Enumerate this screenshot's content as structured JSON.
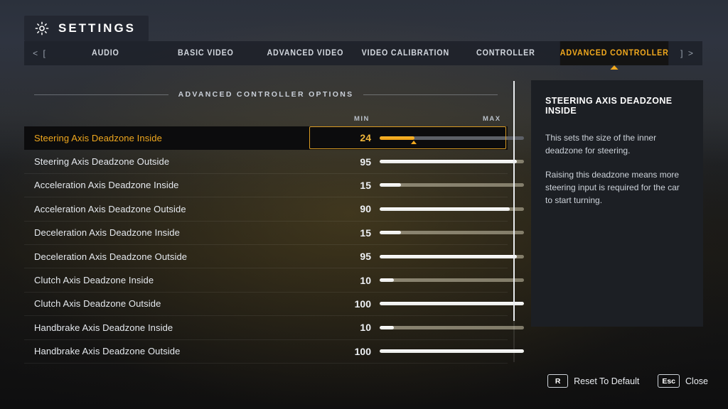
{
  "header": {
    "gear_icon": "gear-icon",
    "title": "SETTINGS"
  },
  "tabbar": {
    "prev_arrow": "< [",
    "next_arrow": "] >",
    "tabs": [
      {
        "label": "AUDIO",
        "active": false
      },
      {
        "label": "BASIC VIDEO",
        "active": false
      },
      {
        "label": "ADVANCED VIDEO",
        "active": false
      },
      {
        "label": "VIDEO CALIBRATION",
        "active": false
      },
      {
        "label": "CONTROLLER",
        "active": false
      },
      {
        "label": "ADVANCED CONTROLLER",
        "active": true
      }
    ]
  },
  "section": {
    "heading": "ADVANCED CONTROLLER OPTIONS",
    "min_label": "MIN",
    "max_label": "MAX"
  },
  "options": [
    {
      "label": "Steering Axis Deadzone Inside",
      "value": "24",
      "percent": 24,
      "selected": true
    },
    {
      "label": "Steering Axis Deadzone Outside",
      "value": "95",
      "percent": 95,
      "selected": false
    },
    {
      "label": "Acceleration Axis Deadzone Inside",
      "value": "15",
      "percent": 15,
      "selected": false
    },
    {
      "label": "Acceleration Axis Deadzone Outside",
      "value": "90",
      "percent": 90,
      "selected": false
    },
    {
      "label": "Deceleration Axis Deadzone Inside",
      "value": "15",
      "percent": 15,
      "selected": false
    },
    {
      "label": "Deceleration Axis Deadzone Outside",
      "value": "95",
      "percent": 95,
      "selected": false
    },
    {
      "label": "Clutch Axis Deadzone Inside",
      "value": "10",
      "percent": 10,
      "selected": false
    },
    {
      "label": "Clutch Axis Deadzone Outside",
      "value": "100",
      "percent": 100,
      "selected": false
    },
    {
      "label": "Handbrake Axis Deadzone Inside",
      "value": "10",
      "percent": 10,
      "selected": false
    },
    {
      "label": "Handbrake Axis Deadzone Outside",
      "value": "100",
      "percent": 100,
      "selected": false
    }
  ],
  "info": {
    "title": "STEERING AXIS DEADZONE INSIDE",
    "paragraphs": [
      "This sets the size of the inner deadzone for steering.",
      "Raising this deadzone means more steering input is required for the car to start turning."
    ]
  },
  "footer": {
    "hints": [
      {
        "key": "R",
        "label": "Reset To Default"
      },
      {
        "key": "Esc",
        "label": "Close"
      }
    ]
  },
  "colors": {
    "accent": "#f0a81e",
    "accent_border": "#d89a23",
    "panel_bg": "#1c1f24",
    "text_primary": "#e6eaef"
  }
}
